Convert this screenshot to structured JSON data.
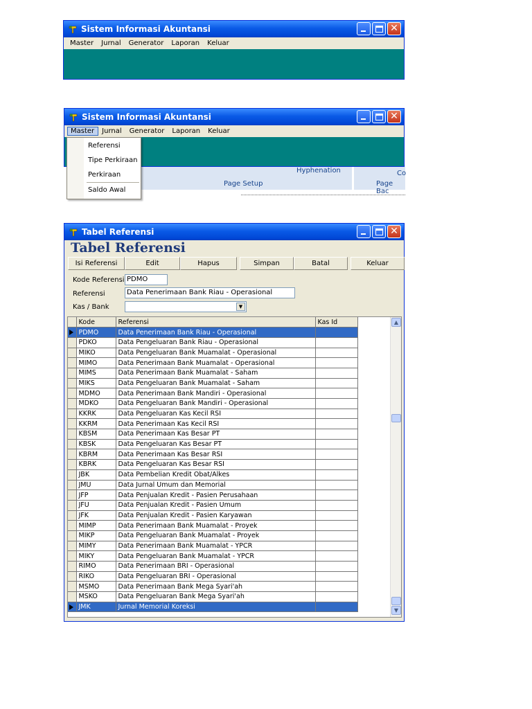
{
  "window1": {
    "title": "Sistem Informasi Akuntansi",
    "menu": [
      "Master",
      "Jurnal",
      "Generator",
      "Laporan",
      "Keluar"
    ]
  },
  "window2": {
    "title": "Sistem Informasi Akuntansi",
    "menu": [
      "Master",
      "Jurnal",
      "Generator",
      "Laporan",
      "Keluar"
    ],
    "dropdown": [
      "Referensi",
      "Tipe Perkiraan",
      "Perkiraan",
      "Saldo Awal"
    ],
    "background": {
      "hyphenation": "Hyphenation",
      "page_setup": "Page Setup",
      "page_back": "Page Bac",
      "co": "Co"
    }
  },
  "window3": {
    "title": "Tabel Referensi",
    "heading": "Tabel Referensi",
    "buttons": [
      "Isi Referensi",
      "Edit",
      "Hapus",
      "Simpan",
      "Batal",
      "Keluar"
    ],
    "form": {
      "kode_label": "Kode Referensi",
      "kode_value": "PDMO",
      "referensi_label": "Referensi",
      "referensi_value": "Data Penerimaan Bank Riau - Operasional",
      "kas_label": "Kas / Bank",
      "kas_value": ""
    },
    "columns": [
      "Kode",
      "Referensi",
      "Kas Id"
    ],
    "rows": [
      {
        "kode": "PDMO",
        "ref": "Data Penerimaan Bank Riau - Operasional",
        "kas": ""
      },
      {
        "kode": "PDKO",
        "ref": "Data Pengeluaran Bank Riau - Operasional",
        "kas": ""
      },
      {
        "kode": "MIKO",
        "ref": "Data Pengeluaran Bank Muamalat - Operasional",
        "kas": ""
      },
      {
        "kode": "MIMO",
        "ref": "Data Penerimaan Bank Muamalat - Operasional",
        "kas": ""
      },
      {
        "kode": "MIMS",
        "ref": "Data Penerimaan Bank Muamalat - Saham",
        "kas": ""
      },
      {
        "kode": "MIKS",
        "ref": "Data Pengeluaran Bank Muamalat - Saham",
        "kas": ""
      },
      {
        "kode": "MDMO",
        "ref": "Data Penerimaan Bank Mandiri - Operasional",
        "kas": ""
      },
      {
        "kode": "MDKO",
        "ref": "Data Pengeluaran Bank Mandiri - Operasional",
        "kas": ""
      },
      {
        "kode": "KKRK",
        "ref": "Data Pengeluaran Kas Kecil RSI",
        "kas": ""
      },
      {
        "kode": "KKRM",
        "ref": "Data Penerimaan Kas Kecil RSI",
        "kas": ""
      },
      {
        "kode": "KBSM",
        "ref": "Data Penerimaan Kas Besar PT",
        "kas": ""
      },
      {
        "kode": "KBSK",
        "ref": "Data Pengeluaran Kas Besar PT",
        "kas": ""
      },
      {
        "kode": "KBRM",
        "ref": "Data Penerimaan Kas Besar RSI",
        "kas": ""
      },
      {
        "kode": "KBRK",
        "ref": "Data Pengeluaran Kas Besar RSI",
        "kas": ""
      },
      {
        "kode": "JBK",
        "ref": "Data Pembelian  Kredit Obat/Alkes",
        "kas": ""
      },
      {
        "kode": "JMU",
        "ref": "Data Jurnal Umum dan Memorial",
        "kas": ""
      },
      {
        "kode": "JFP",
        "ref": "Data Penjualan Kredit - Pasien Perusahaan",
        "kas": ""
      },
      {
        "kode": "JFU",
        "ref": "Data Penjualan Kredit - Pasien Umum",
        "kas": ""
      },
      {
        "kode": "JFK",
        "ref": "Data Penjualan Kredit - Pasien Karyawan",
        "kas": ""
      },
      {
        "kode": "MIMP",
        "ref": "Data Penerimaan Bank Muamalat - Proyek",
        "kas": ""
      },
      {
        "kode": "MIKP",
        "ref": "Data Pengeluaran Bank Muamalat - Proyek",
        "kas": ""
      },
      {
        "kode": "MIMY",
        "ref": "Data Penerimaan Bank Muamalat - YPCR",
        "kas": ""
      },
      {
        "kode": "MIKY",
        "ref": "Data Pengeluaran Bank Muamalat - YPCR",
        "kas": ""
      },
      {
        "kode": "RIMO",
        "ref": "Data Penerimaan BRI - Operasional",
        "kas": ""
      },
      {
        "kode": "RIKO",
        "ref": "Data Pengeluaran BRI - Operasional",
        "kas": ""
      },
      {
        "kode": "MSMO",
        "ref": "Data Penerimaan Bank Mega Syari'ah",
        "kas": ""
      },
      {
        "kode": "MSKO",
        "ref": "Data Pengeluaran Bank Mega Syari'ah",
        "kas": ""
      },
      {
        "kode": "JMK",
        "ref": "Jurnal Memorial Koreksi",
        "kas": ""
      }
    ],
    "selected_rows": [
      0,
      27
    ]
  },
  "colors": {
    "teal": "#008080",
    "selection": "#316ac5",
    "title_blue": "#0a5ae6",
    "heading": "#1f3a7a"
  }
}
